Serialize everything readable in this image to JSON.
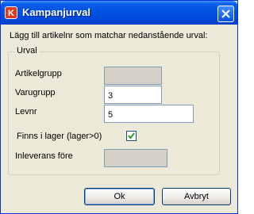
{
  "window": {
    "title": "Kampanjurval",
    "icon_letter": "K"
  },
  "instruction": "Lägg till artikelnr som matchar nedanstående urval:",
  "group": {
    "legend": "Urval",
    "artikelgrupp": {
      "label": "Artikelgrupp",
      "value": ""
    },
    "varugrupp": {
      "label": "Varugrupp",
      "value": "3"
    },
    "levnr": {
      "label": "Levnr",
      "value": "5"
    },
    "finns_i_lager": {
      "label": "Finns i lager (lager>0)",
      "checked": true
    },
    "inleverans_fore": {
      "label": "Inleverans före",
      "value": ""
    }
  },
  "buttons": {
    "ok": "Ok",
    "cancel": "Avbryt"
  }
}
